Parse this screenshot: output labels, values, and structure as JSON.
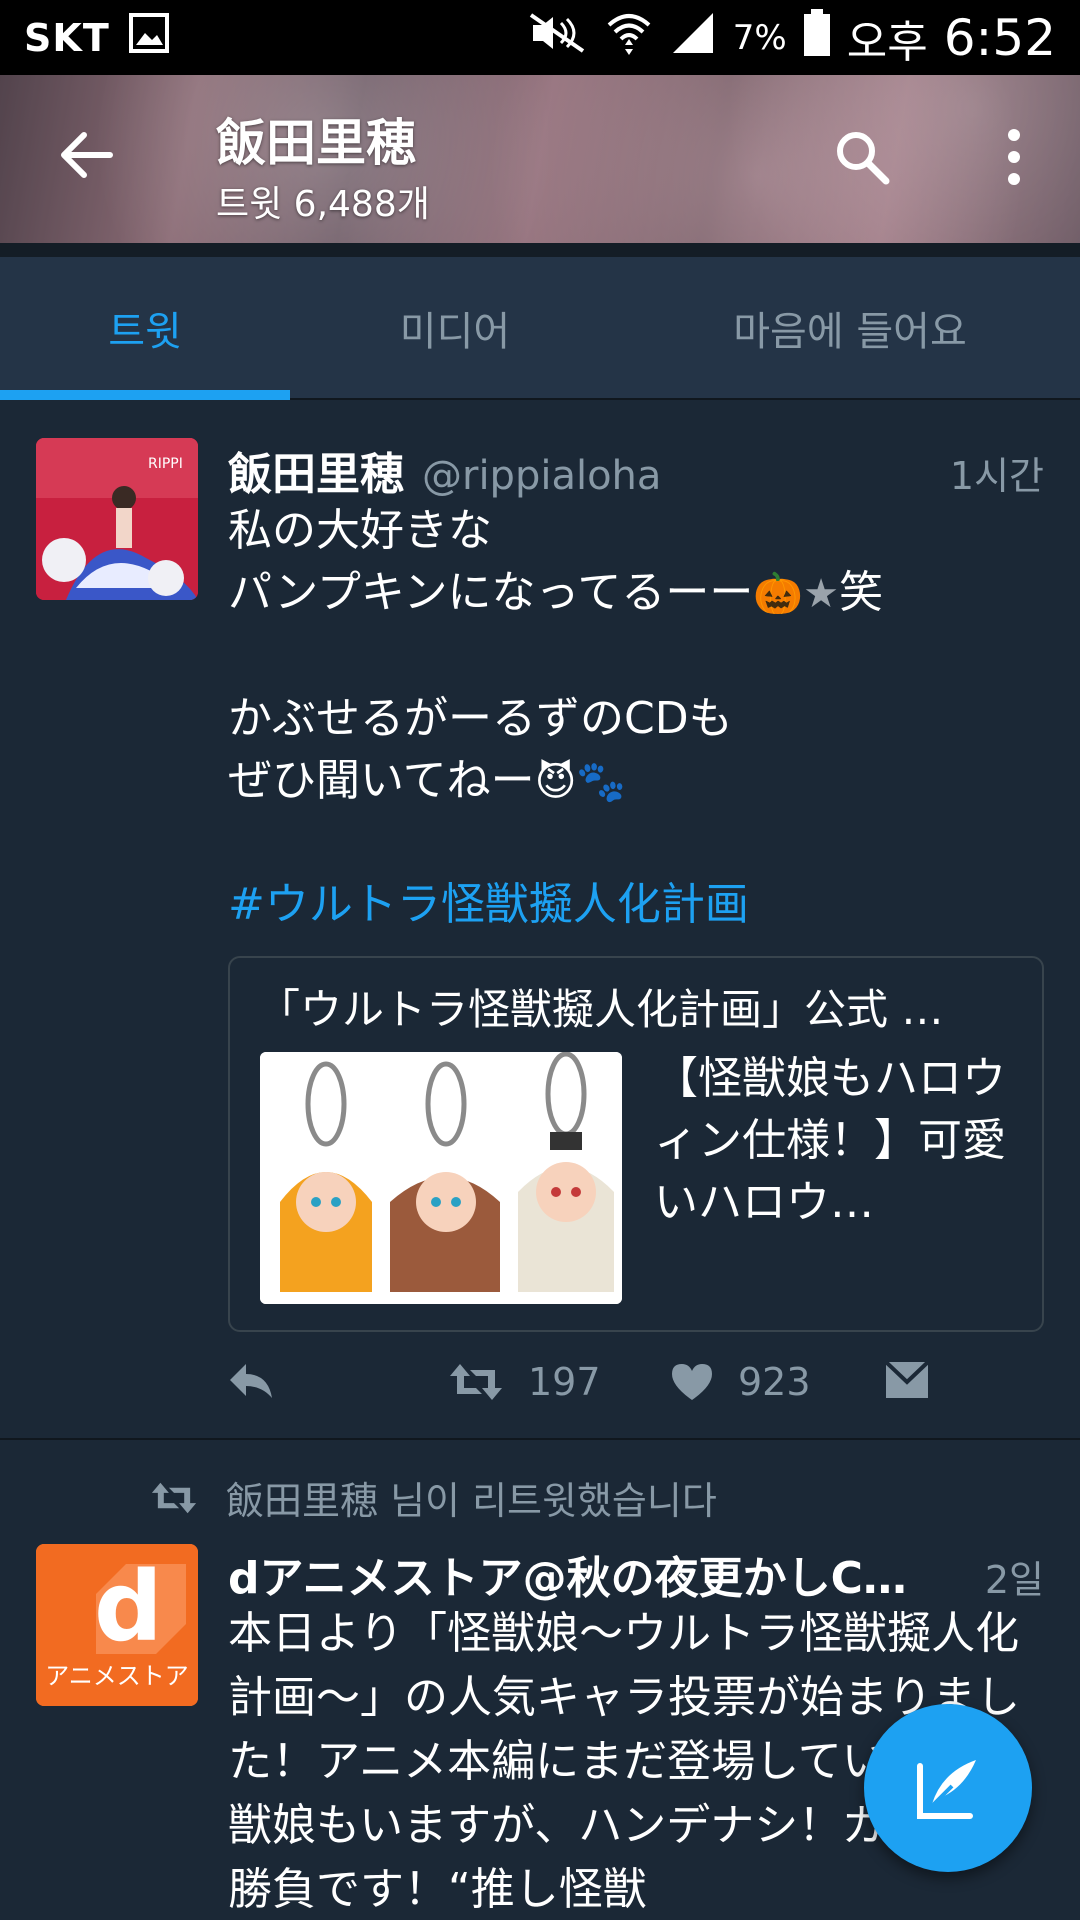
{
  "status_bar": {
    "carrier": "SKT",
    "battery": "7%",
    "ampm": "오후",
    "time": "6:52"
  },
  "header": {
    "title": "飯田里穂",
    "subtitle": "트윗 6,488개"
  },
  "tabs": [
    {
      "label": "트윗",
      "active": true
    },
    {
      "label": "미디어",
      "active": false
    },
    {
      "label": "마음에 들어요",
      "active": false
    }
  ],
  "tweet1": {
    "name": "飯田里穂",
    "handle": "@rippialoha",
    "time": "1시간",
    "line1": "私の大好きな",
    "line2": "パンプキンになってるーー",
    "line2_suffix": "笑",
    "line3": "かぶせるがーるずのCDも",
    "line4": "ぜひ聞いてねー",
    "hashtag": "#ウルトラ怪獣擬人化計画",
    "card": {
      "title": "「ウルトラ怪獣擬人化計画」公式 …",
      "description": "【怪獣娘もハロウィン仕様！】可愛いハロウ…"
    },
    "retweets": "197",
    "likes": "923"
  },
  "tweet2": {
    "retweeted_by": "飯田里穂 님이 리트윗했습니다",
    "name": "dアニメストア@秋の夜更かしC…",
    "time": "2일",
    "avatar_label": "アニメストア",
    "text": "本日より「怪獣娘～ウルトラ怪獣擬人化計画～」の人気キャラ投票が始まりました！アニメ本編にまだ登場していない怪獣娘もいますが、ハンデナシ！ガチンコ勝負です！“推し怪獣"
  },
  "colors": {
    "background": "#1b2836",
    "accent": "#1da1f2",
    "secondary_text": "#8899a6",
    "tab_bar": "#243447"
  }
}
